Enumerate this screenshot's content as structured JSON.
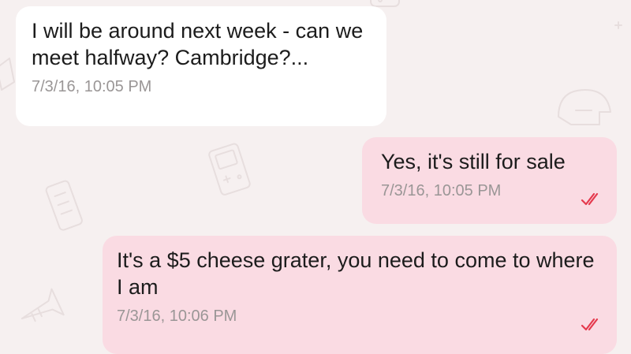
{
  "messages": [
    {
      "direction": "incoming",
      "text": "I will be around next week - can we meet halfway? Cambridge?...",
      "timestamp": "7/3/16, 10:05 PM"
    },
    {
      "direction": "outgoing",
      "text": "Yes, it's still for sale",
      "timestamp": "7/3/16, 10:05 PM",
      "status_icon": "double-check-read-icon"
    },
    {
      "direction": "outgoing",
      "text": "It's a $5 cheese grater, you need to come to where I am",
      "timestamp": "7/3/16, 10:06 PM",
      "status_icon": "double-check-read-icon"
    }
  ],
  "colors": {
    "background": "#f6f0f0",
    "incoming_bubble": "#ffffff",
    "outgoing_bubble": "#fadbe3",
    "text": "#1c1c1c",
    "timestamp": "#9a9696",
    "read_check": "#e53a4e"
  },
  "background_icons": [
    "gamepad-icon",
    "helmet-icon",
    "handheld-console-icon",
    "remote-icon",
    "trumpet-icon",
    "ruler-icon"
  ]
}
